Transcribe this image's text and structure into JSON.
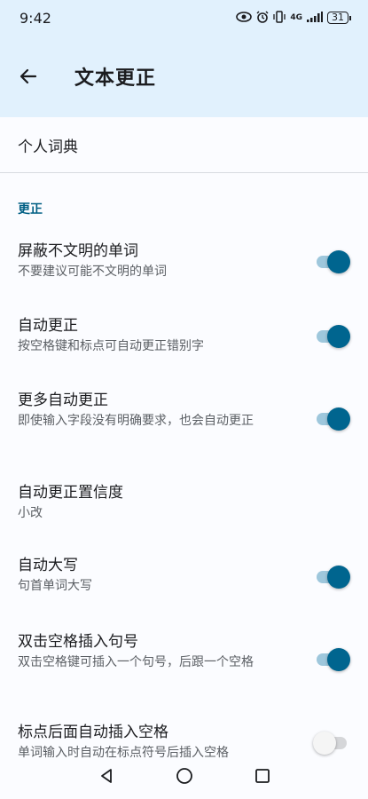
{
  "status_bar": {
    "time": "9:42",
    "network": "4G",
    "battery": "31",
    "icons": [
      "eye-icon",
      "alarm-icon",
      "vibrate-icon",
      "signal-icon",
      "battery-icon"
    ]
  },
  "app_bar": {
    "title": "文本更正",
    "back_icon": "arrow-left-icon"
  },
  "personal_dictionary": {
    "label": "个人词典"
  },
  "section": {
    "header": "更正"
  },
  "settings": [
    {
      "title": "屏蔽不文明的单词",
      "summary": "不要建议可能不文明的单词",
      "toggle": true
    },
    {
      "title": "自动更正",
      "summary": "按空格键和标点可自动更正错别字",
      "toggle": true
    },
    {
      "title": "更多自动更正",
      "summary": "即使输入字段没有明确要求，也会自动更正",
      "toggle": true
    },
    {
      "title": "自动更正置信度",
      "summary": "小改"
    },
    {
      "title": "自动大写",
      "summary": "句首单词大写",
      "toggle": true
    },
    {
      "title": "双击空格插入句号",
      "summary": "双击空格键可插入一个句号，后跟一个空格",
      "toggle": true
    },
    {
      "title": "标点后面自动插入空格",
      "summary": "单词输入时自动在标点符号后插入空格",
      "toggle": false
    }
  ],
  "nav_bar": {
    "icons": [
      "back-triangle-icon",
      "home-circle-icon",
      "recents-square-icon"
    ]
  },
  "colors": {
    "accent": "#00658f",
    "header_bg": "#e1f1fd",
    "section": "#005f84"
  }
}
